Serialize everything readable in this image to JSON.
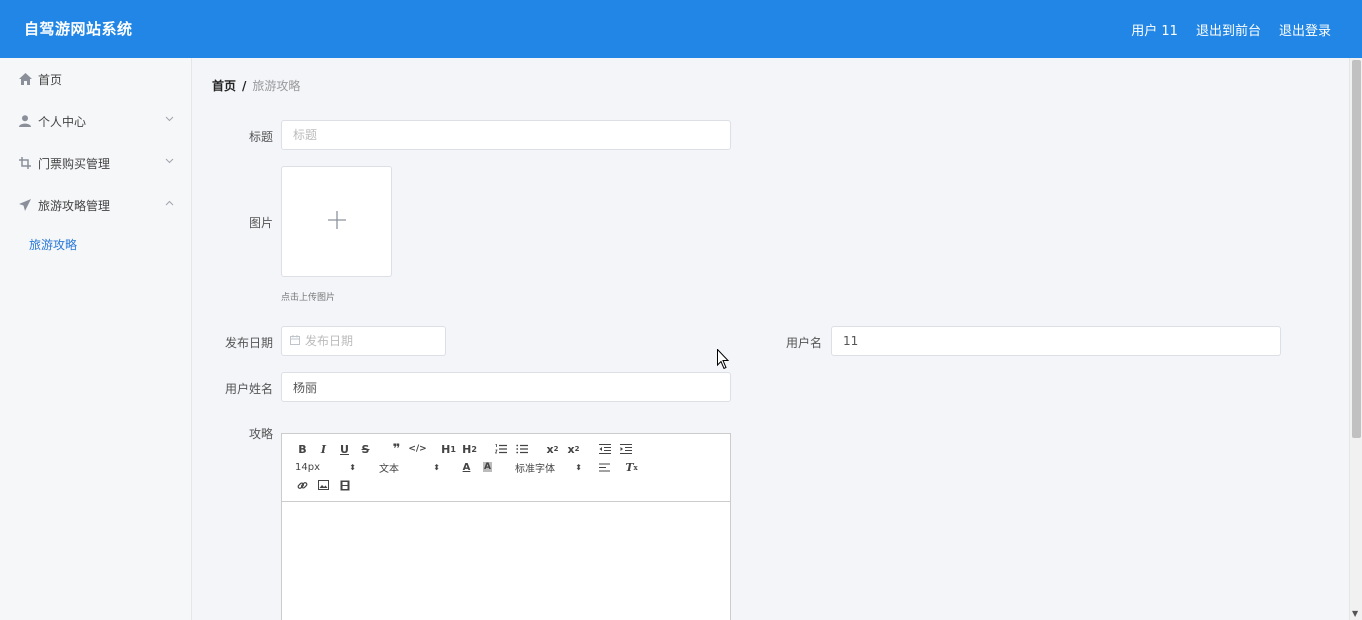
{
  "header": {
    "title": "自驾游网站系统",
    "user": "用户 11",
    "to_front": "退出到前台",
    "logout": "退出登录"
  },
  "sidebar": {
    "items": [
      {
        "label": "首页",
        "icon": "home-icon"
      },
      {
        "label": "个人中心",
        "icon": "user-icon"
      },
      {
        "label": "门票购买管理",
        "icon": "crop-icon"
      },
      {
        "label": "旅游攻略管理",
        "icon": "send-icon"
      }
    ],
    "submenu": {
      "label": "旅游攻略"
    }
  },
  "breadcrumb": {
    "home": "首页",
    "separator": "/",
    "current": "旅游攻略"
  },
  "form": {
    "title_label": "标题",
    "title_placeholder": "标题",
    "image_label": "图片",
    "upload_hint": "点击上传图片",
    "date_label": "发布日期",
    "date_placeholder": "发布日期",
    "username_label": "用户名",
    "username_value": "11",
    "realname_label": "用户姓名",
    "realname_value": "杨丽",
    "content_label": "攻略"
  },
  "editor": {
    "size_select": "14px",
    "heading_select": "文本",
    "font_select": "标准字体"
  },
  "colors": {
    "header_bg": "#2186e5",
    "active_sub": "#2a7ad6"
  }
}
